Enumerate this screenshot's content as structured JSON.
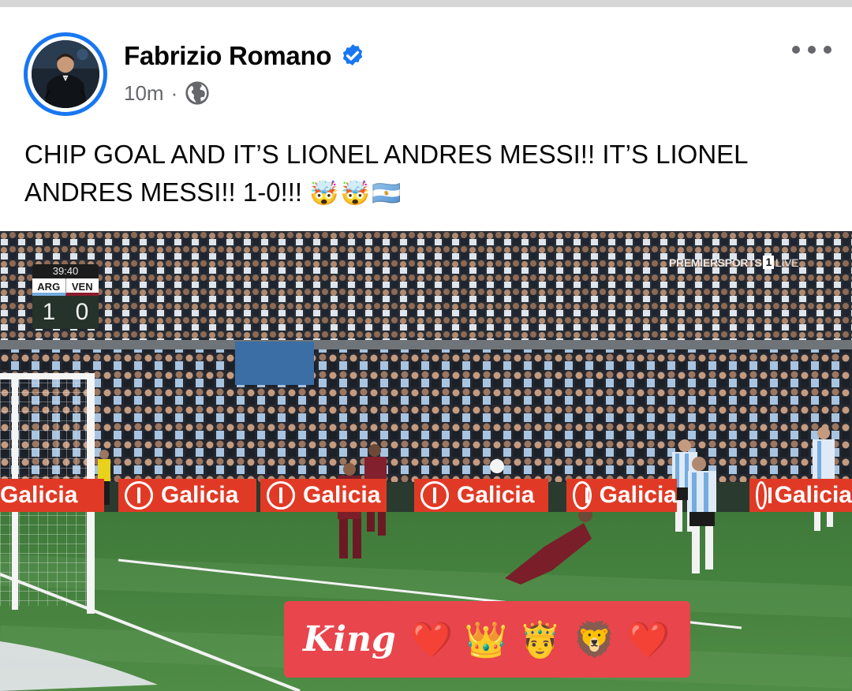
{
  "post": {
    "author_name": "Fabrizio Romano",
    "verified_icon": "verified-badge-icon",
    "timestamp": "10m",
    "separator": "·",
    "audience_icon": "globe-icon",
    "more_icon": "more-options-icon",
    "text": "CHIP GOAL AND IT’S LIONEL ANDRES MESSI!! IT’S LIONEL ANDRES MESSI!! 1-0!!!",
    "text_emojis": "🤯🤯🇦🇷"
  },
  "media": {
    "scorebug": {
      "clock": "39:40",
      "home_team": "ARG",
      "away_team": "VEN",
      "home_score": "1",
      "away_score": "0"
    },
    "broadcaster": {
      "name": "PREMIERSPORTS",
      "channel": "1",
      "live": "LIVE"
    },
    "ad_boards": [
      "Galicia",
      "Galicia",
      "Galicia",
      "Galicia",
      "Galicia",
      "Galicia"
    ],
    "sticker": {
      "text": "King",
      "emojis": "❤️👑🤴🦁❤️"
    }
  },
  "colors": {
    "accent": "#1877f2",
    "secondary_text": "#65676b",
    "sticker_bg": "#e8454c",
    "ad_board": "#e03a26"
  }
}
